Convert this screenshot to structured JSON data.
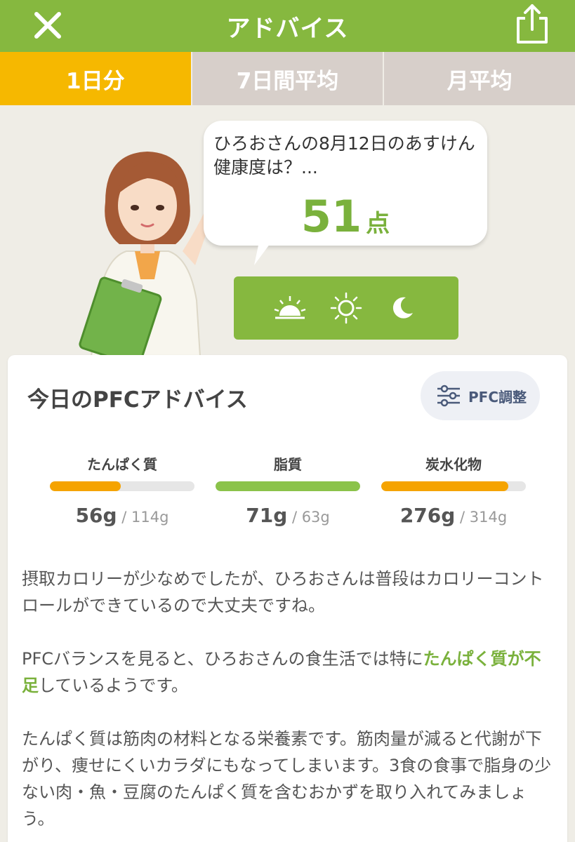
{
  "header": {
    "title": "アドバイス",
    "close_icon": "close-icon",
    "share_icon": "share-icon",
    "color": "#86b83f"
  },
  "tabs": [
    {
      "label": "1日分",
      "active": true
    },
    {
      "label": "7日間平均",
      "active": false
    },
    {
      "label": "月平均",
      "active": false
    }
  ],
  "bubble": {
    "line1": "ひろおさんの8月12日のあすけん",
    "line2": "健康度は？...",
    "score": "51",
    "score_unit": "点"
  },
  "time_icons": [
    "sunrise-icon",
    "sun-icon",
    "moon-icon"
  ],
  "card": {
    "title": "今日のPFCアドバイス",
    "pfc_button": "PFC調整",
    "nutrients": [
      {
        "label": "たんぱく質",
        "value": "56g",
        "target": " / 114g",
        "ratio": 0.49,
        "color": "#f5a300"
      },
      {
        "label": "脂質",
        "value": "71g",
        "target": " / 63g",
        "ratio": 1.0,
        "color": "#8bc34a"
      },
      {
        "label": "炭水化物",
        "value": "276g",
        "target": " / 314g",
        "ratio": 0.88,
        "color": "#f5a300"
      }
    ],
    "advice": {
      "p1": "摂取カロリーが少なめでしたが、ひろおさんは普段はカロリーコントロールができているので大丈夫ですね。",
      "p2_before": "PFCバランスを見ると、ひろおさんの食生活では特に",
      "p2_highlight": "たんぱく質が不足",
      "p2_after": "しているようです。",
      "p3": "たんぱく質は筋肉の材料となる栄養素です。筋肉量が減ると代謝が下がり、痩せにくいカラダにもなってしまいます。3食の食事で脂身の少ない肉・魚・豆腐のたんぱく質を含むおかずを取り入れてみましょう。"
    }
  }
}
